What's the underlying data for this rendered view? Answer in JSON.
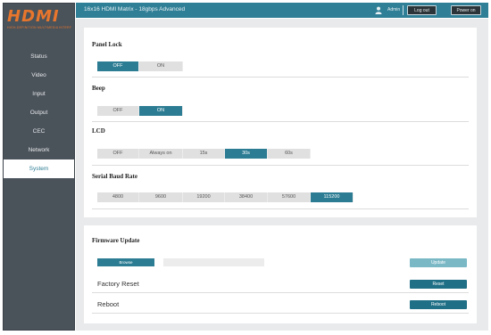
{
  "app": {
    "logo_text": "HDMI",
    "logo_subtitle": "HIGH-DEFINITION MULTIMEDIA INTERFACE",
    "title": "16x16 HDMI Matrix - 18gbps Advanced",
    "user": "Admin",
    "logout_label": "Log out",
    "power_label": "Power on"
  },
  "sidebar": {
    "items": [
      {
        "label": "Status"
      },
      {
        "label": "Video"
      },
      {
        "label": "Input"
      },
      {
        "label": "Output"
      },
      {
        "label": "CEC"
      },
      {
        "label": "Network"
      },
      {
        "label": "System"
      }
    ],
    "active": "System"
  },
  "system": {
    "panel_lock": {
      "title": "Panel Lock",
      "options": [
        "OFF",
        "ON"
      ],
      "selected": "OFF"
    },
    "beep": {
      "title": "Beep",
      "options": [
        "OFF",
        "ON"
      ],
      "selected": "ON"
    },
    "lcd": {
      "title": "LCD",
      "options": [
        "OFF",
        "Always on",
        "15s",
        "30s",
        "60s"
      ],
      "selected": "30s"
    },
    "baud": {
      "title": "Serial Baud Rate",
      "options": [
        "4800",
        "9600",
        "19200",
        "38400",
        "57600",
        "115200"
      ],
      "selected": "115200"
    }
  },
  "maintenance": {
    "firmware_title": "Firmware Update",
    "browse_label": "Browse",
    "update_label": "Update",
    "factory_reset_title": "Factory Reset",
    "reset_label": "Reset",
    "reboot_title": "Reboot",
    "reboot_label": "Reboot"
  },
  "colors": {
    "accent": "#2c7c93",
    "sidebar": "#4a525a",
    "logo": "#e8762c",
    "update_disabled": "#7ab8c6"
  }
}
